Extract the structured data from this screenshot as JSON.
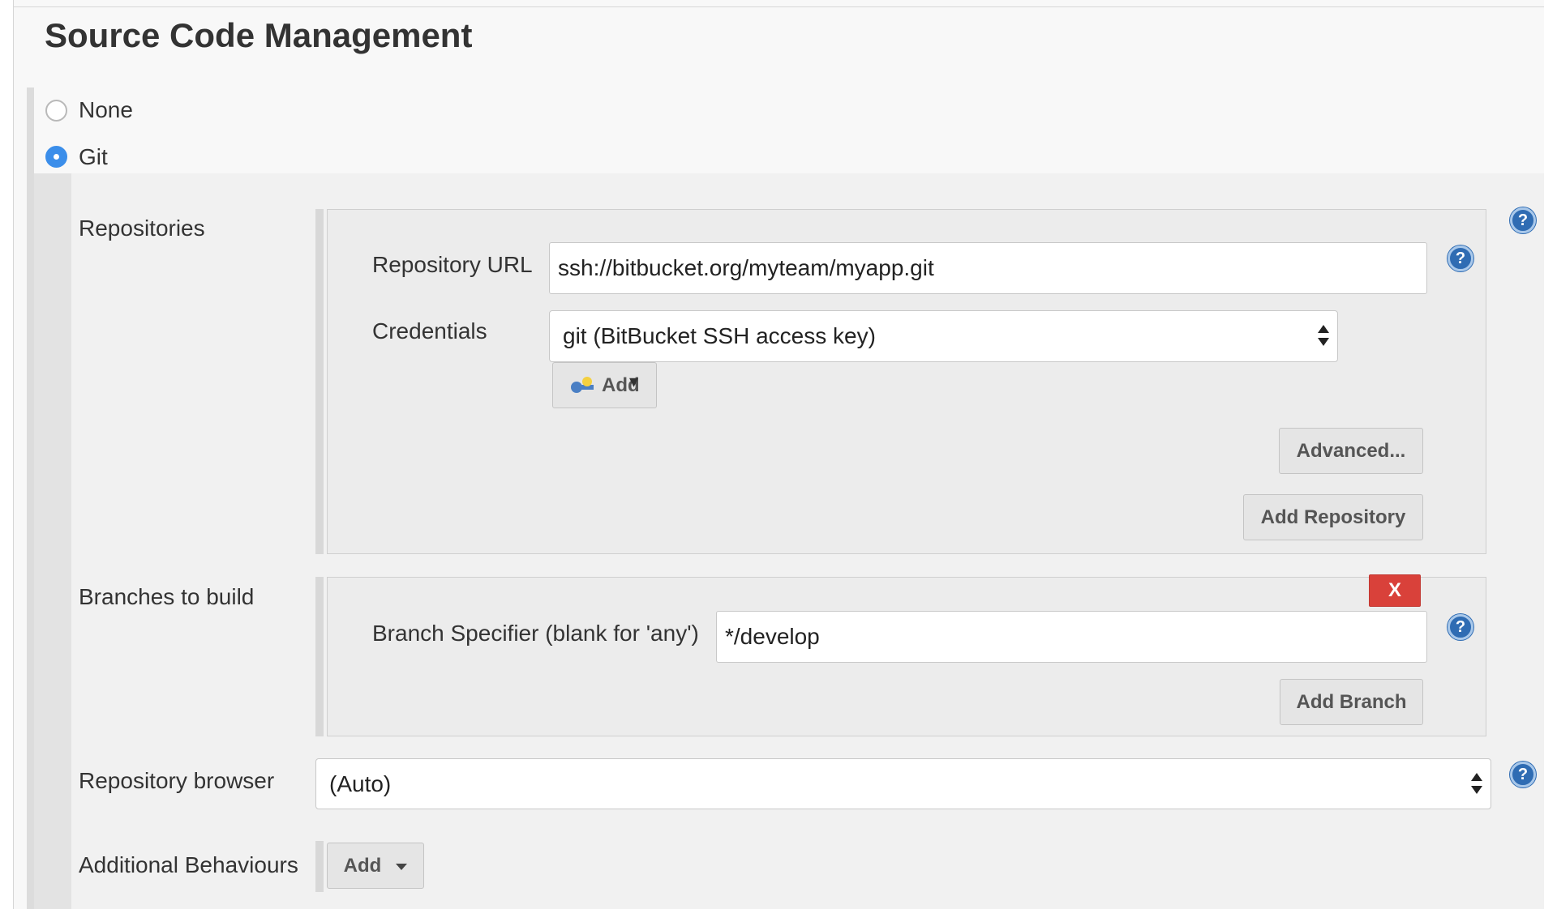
{
  "section_title": "Source Code Management",
  "scm_options": [
    {
      "label": "None",
      "selected": false
    },
    {
      "label": "Git",
      "selected": true
    }
  ],
  "repositories": {
    "label": "Repositories",
    "url_label": "Repository URL",
    "url_value": "ssh://bitbucket.org/myteam/myapp.git",
    "credentials_label": "Credentials",
    "credentials_value": "git (BitBucket SSH access key)",
    "add_credentials_label": "Add",
    "advanced_label": "Advanced...",
    "add_repository_label": "Add Repository"
  },
  "branches": {
    "label": "Branches to build",
    "delete_label": "X",
    "specifier_label": "Branch Specifier (blank for 'any')",
    "specifier_value": "*/develop",
    "add_branch_label": "Add Branch"
  },
  "repository_browser": {
    "label": "Repository browser",
    "value": "(Auto)"
  },
  "additional_behaviours": {
    "label": "Additional Behaviours",
    "add_label": "Add"
  },
  "help_icon_glyph": "?",
  "colors": {
    "radio_selected": "#3b8eea",
    "delete_button": "#d9413a",
    "help_icon": "#2f6cb3"
  }
}
